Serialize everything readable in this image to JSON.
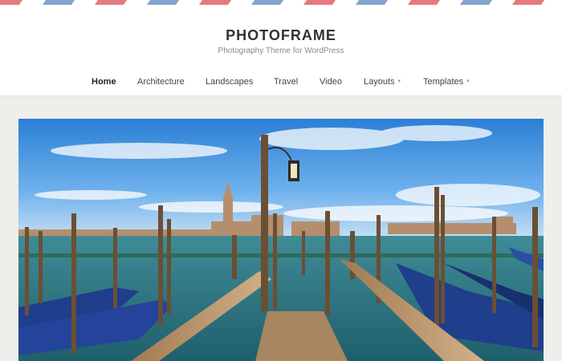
{
  "site": {
    "title": "PHOTOFRAME",
    "tagline": "Photography Theme for WordPress"
  },
  "nav": {
    "items": [
      {
        "label": "Home",
        "active": true,
        "has_dropdown": false
      },
      {
        "label": "Architecture",
        "active": false,
        "has_dropdown": false
      },
      {
        "label": "Landscapes",
        "active": false,
        "has_dropdown": false
      },
      {
        "label": "Travel",
        "active": false,
        "has_dropdown": false
      },
      {
        "label": "Video",
        "active": false,
        "has_dropdown": false
      },
      {
        "label": "Layouts",
        "active": false,
        "has_dropdown": true
      },
      {
        "label": "Templates",
        "active": false,
        "has_dropdown": true
      }
    ],
    "dropdown_glyph": "▾"
  },
  "colors": {
    "airmail_red": "#e0626c",
    "airmail_blue": "#6f93c6",
    "background": "#efeeea",
    "header": "#ffffff"
  },
  "hero": {
    "icon": "venice-gondola-photo"
  }
}
